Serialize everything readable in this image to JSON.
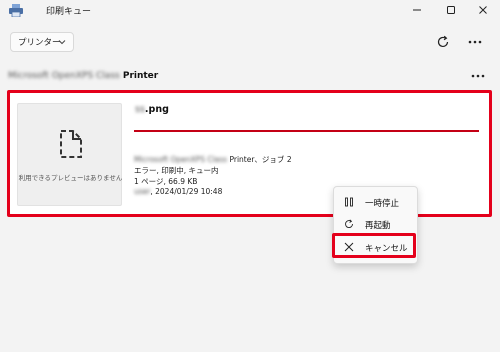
{
  "window": {
    "title": "印刷キュー",
    "controls": [
      "minimize-icon",
      "maximize-icon",
      "close-icon"
    ]
  },
  "toolbar": {
    "printer_button_label": "プリンター",
    "refresh_icon": "refresh-icon",
    "more_icon": "more-horizontal-icon"
  },
  "printer": {
    "name_blurred": "Microsoft OpenXPS Class",
    "name_suffix": "Printer"
  },
  "job": {
    "file_name_blurred": "ss",
    "file_name_ext": ".png",
    "preview_text": "利用できるプレビューはありません",
    "progress": 1.0,
    "line1_blurred": "Microsoft OpenXPS Class",
    "line1_suffix": "Printer、ジョブ 2",
    "line2": "エラー, 印刷中, キュー内",
    "line3": "1 ページ, 66.9 KB",
    "line4_blurred": "user",
    "line4_suffix": ", 2024/01/29 10:48"
  },
  "context_menu": {
    "items": [
      {
        "label": "一時停止",
        "icon": "pause-icon"
      },
      {
        "label": "再起動",
        "icon": "restart-icon"
      },
      {
        "label": "キャンセル",
        "icon": "cancel-x-icon"
      }
    ]
  },
  "colors": {
    "highlight": "#e4001b",
    "progress": "#c40015",
    "background": "#f3f3f3"
  }
}
